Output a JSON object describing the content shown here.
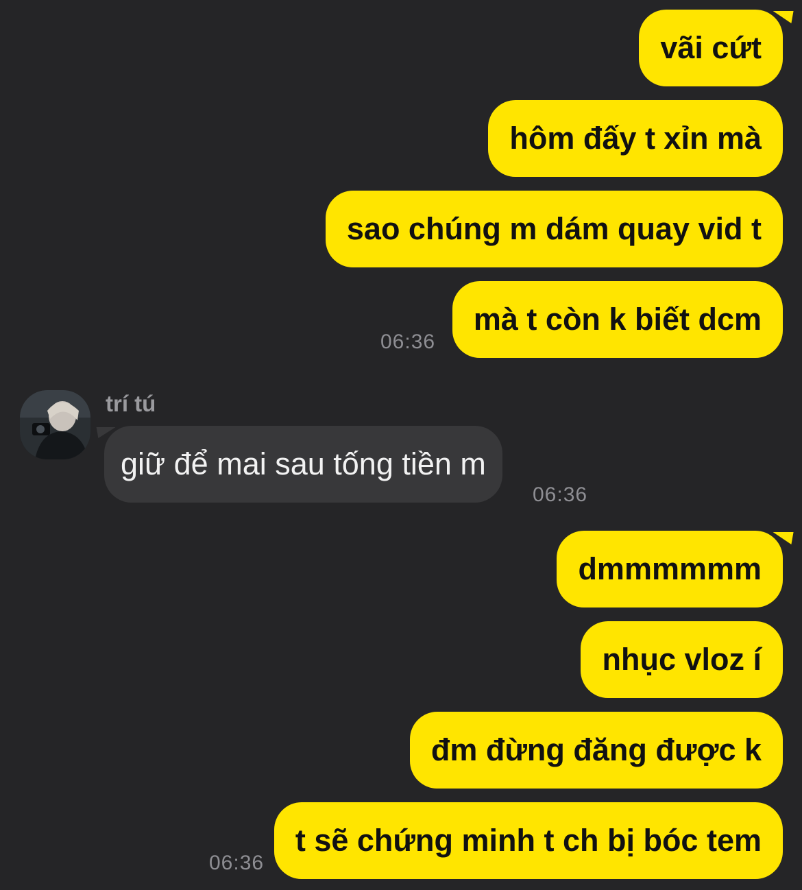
{
  "conversation": {
    "outgoing_group_1": [
      {
        "text": "vãi cứt"
      },
      {
        "text": "hôm đấy t xỉn mà"
      },
      {
        "text": "sao chúng m dám quay vid t"
      },
      {
        "text": "mà t còn k biết dcm"
      }
    ],
    "outgoing_group_1_time": "06:36",
    "incoming": {
      "sender_name": "trí tú",
      "text": "giữ để mai sau tống tiền m",
      "time": "06:36"
    },
    "outgoing_group_2": [
      {
        "text": "dmmmmmm"
      },
      {
        "text": "nhục vloz í"
      },
      {
        "text": "đm đừng đăng được k"
      },
      {
        "text": "t sẽ chứng minh t ch bị bóc tem"
      }
    ],
    "outgoing_group_2_time": "06:36"
  },
  "colors": {
    "background": "#252527",
    "outgoing_bubble": "#ffe500",
    "incoming_bubble": "#38383a",
    "timestamp": "#8e8e93"
  }
}
